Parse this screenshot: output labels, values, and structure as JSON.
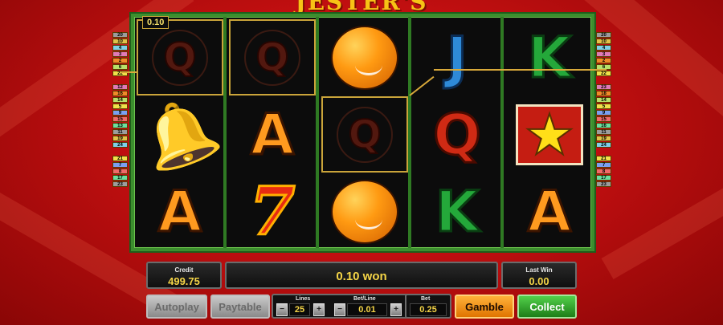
{
  "game": {
    "title": "JESTER'S LUCK"
  },
  "bet_indicator": "0.10",
  "colors": {
    "board_border": "#3c8e2e",
    "payline": "#d9a93a",
    "value_text": "#f5d547",
    "background": "#c10f10"
  },
  "reels": [
    [
      {
        "symbol": "Q",
        "variant": "dim",
        "highlight": true
      },
      {
        "symbol": "bell-icon"
      },
      {
        "symbol": "A"
      }
    ],
    [
      {
        "symbol": "Q",
        "variant": "dim",
        "highlight": true
      },
      {
        "symbol": "A"
      },
      {
        "symbol": "7"
      }
    ],
    [
      {
        "symbol": "orange-icon"
      },
      {
        "symbol": "Q",
        "variant": "dim",
        "highlight": true
      },
      {
        "symbol": "orange-icon"
      }
    ],
    [
      {
        "symbol": "J"
      },
      {
        "symbol": "Q"
      },
      {
        "symbol": "K"
      }
    ],
    [
      {
        "symbol": "K"
      },
      {
        "symbol": "star-icon"
      },
      {
        "symbol": "A"
      }
    ]
  ],
  "line_markers": {
    "left": [
      [
        "20",
        "10",
        "4",
        "3",
        "2",
        "6",
        "22"
      ],
      [
        "12",
        "16",
        "14",
        "5",
        "9",
        "15",
        "13",
        "11",
        "19",
        "24"
      ],
      [
        "21",
        "7",
        "8",
        "17",
        "23"
      ]
    ],
    "right": [
      [
        "20",
        "10",
        "4",
        "3",
        "2",
        "6",
        "22"
      ],
      [
        "23",
        "18",
        "14",
        "5",
        "9",
        "15",
        "16",
        "11",
        "19",
        "24"
      ],
      [
        "21",
        "7",
        "8",
        "17",
        "23"
      ]
    ]
  },
  "status": {
    "credit_label": "Credit",
    "credit_value": "499.75",
    "win_message": "0.10 won",
    "last_win_label": "Last Win",
    "last_win_value": "0.00"
  },
  "controls": {
    "autoplay_label": "Autoplay",
    "paytable_label": "Paytable",
    "lines_label": "Lines",
    "lines_value": "25",
    "bet_line_label": "Bet/Line",
    "bet_line_value": "0.01",
    "bet_label": "Bet",
    "bet_value": "0.25",
    "minus_glyph": "−",
    "plus_glyph": "+",
    "gamble_label": "Gamble",
    "collect_label": "Collect"
  }
}
